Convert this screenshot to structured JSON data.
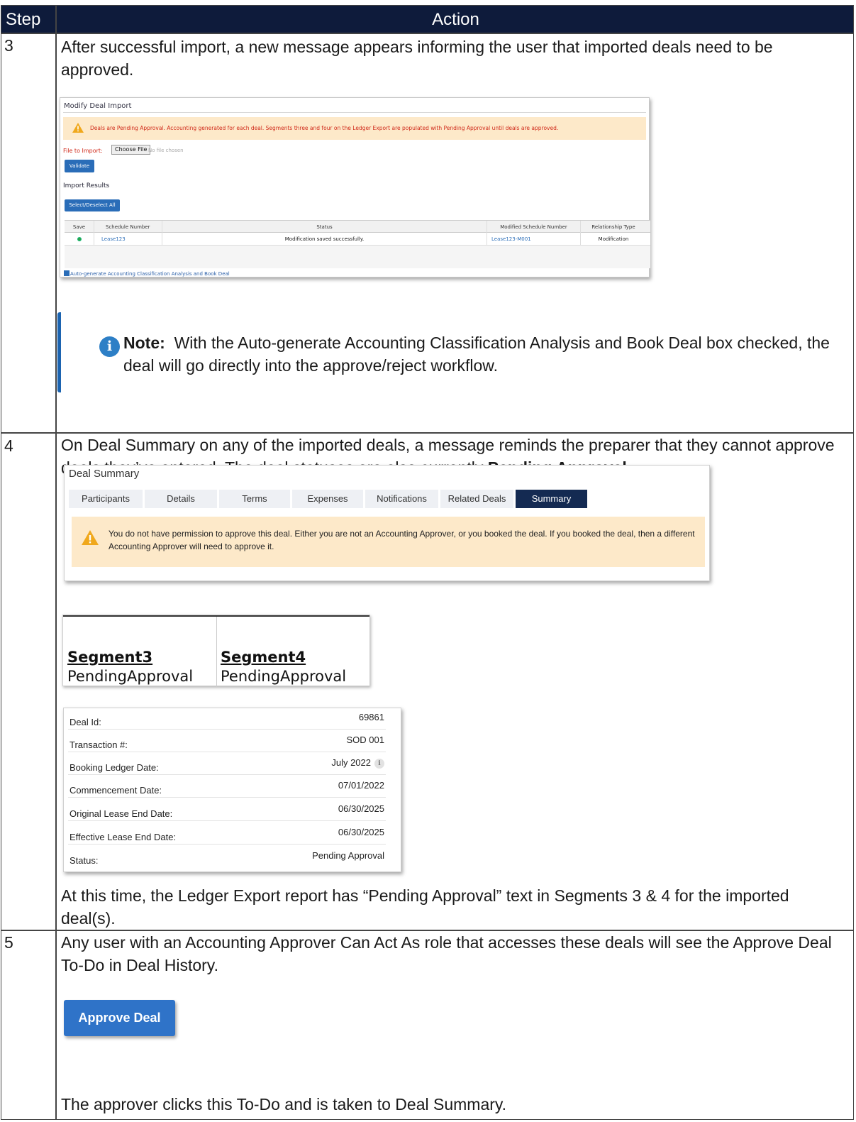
{
  "header": {
    "step": "Step",
    "action": "Action"
  },
  "rows": {
    "step3": {
      "num": "3",
      "text": "After successful import, a new message appears informing the user that imported deals need to be approved."
    },
    "step4": {
      "num": "4",
      "text_a": "On Deal Summary on any of the imported deals, a message reminds the preparer that they cannot approve deals they’ve entered. The deal statuses are also currently ",
      "text_bold": "Pending Approval",
      "text_b": ".",
      "after": "At this time, the Ledger Export report has “Pending Approval” text in Segments 3 & 4 for the imported deal(s)."
    },
    "step5": {
      "num": "5",
      "text": "Any user with an Accounting Approver Can Act As role that accesses these deals will see the Approve Deal To-Do in Deal History.",
      "after": "The approver clicks this To-Do and is taken to Deal Summary."
    }
  },
  "modify_import": {
    "title": "Modify Deal Import",
    "warning": "Deals are Pending Approval. Accounting generated for each deal. Segments three and four on the Ledger Export are populated with Pending Approval until deals are approved.",
    "file_label": "File to Import:",
    "choose_file": "Choose File",
    "no_file": "No file chosen",
    "validate": "Validate",
    "results_title": "Import Results",
    "select_deselect": "Select/Deselect All",
    "columns": [
      "Save",
      "Schedule Number",
      "Status",
      "Modified Schedule Number",
      "Relationship Type"
    ],
    "row": {
      "schedule": "Lease123",
      "status": "Modification saved successfully.",
      "modified": "Lease123-M001",
      "relationship": "Modification"
    },
    "auto_generate": "Auto-generate Accounting Classification Analysis and Book Deal"
  },
  "note": {
    "label": "Note:",
    "text": "With the Auto-generate Accounting Classification Analysis and Book Deal box checked, the deal will go directly into the approve/reject workflow."
  },
  "deal_summary": {
    "title": "Deal Summary",
    "tabs": [
      "Participants",
      "Details",
      "Terms",
      "Expenses",
      "Notifications",
      "Related Deals",
      "Summary"
    ],
    "active_tab": "Summary",
    "warning": "You do not have permission to approve this deal. Either you are not an Accounting Approver, or you booked the deal. If you booked the deal, then a different Accounting Approver will need to approve it."
  },
  "segments": {
    "headers": [
      "Segment3",
      "Segment4"
    ],
    "values": [
      "PendingApproval",
      "PendingApproval"
    ]
  },
  "deal_details": [
    {
      "label": "Deal Id:",
      "value": "69861"
    },
    {
      "label": "Transaction #:",
      "value": "SOD 001"
    },
    {
      "label": "Booking Ledger Date:",
      "value": "July 2022"
    },
    {
      "label": "Commencement Date:",
      "value": "07/01/2022"
    },
    {
      "label": "Original Lease End Date:",
      "value": "06/30/2025"
    },
    {
      "label": "Effective Lease End Date:",
      "value": "06/30/2025"
    },
    {
      "label": "Status:",
      "value": "Pending Approval"
    }
  ],
  "approve_button": "Approve Deal",
  "colors": {
    "header_bg": "#0e1b3b",
    "accent_blue": "#2f73c8",
    "warning_bg": "#fde9c9",
    "active_tab": "#142a52",
    "error_red": "#d02a1a"
  },
  "icons": {
    "warning": "warning-triangle-icon",
    "info": "info-circle-icon"
  }
}
